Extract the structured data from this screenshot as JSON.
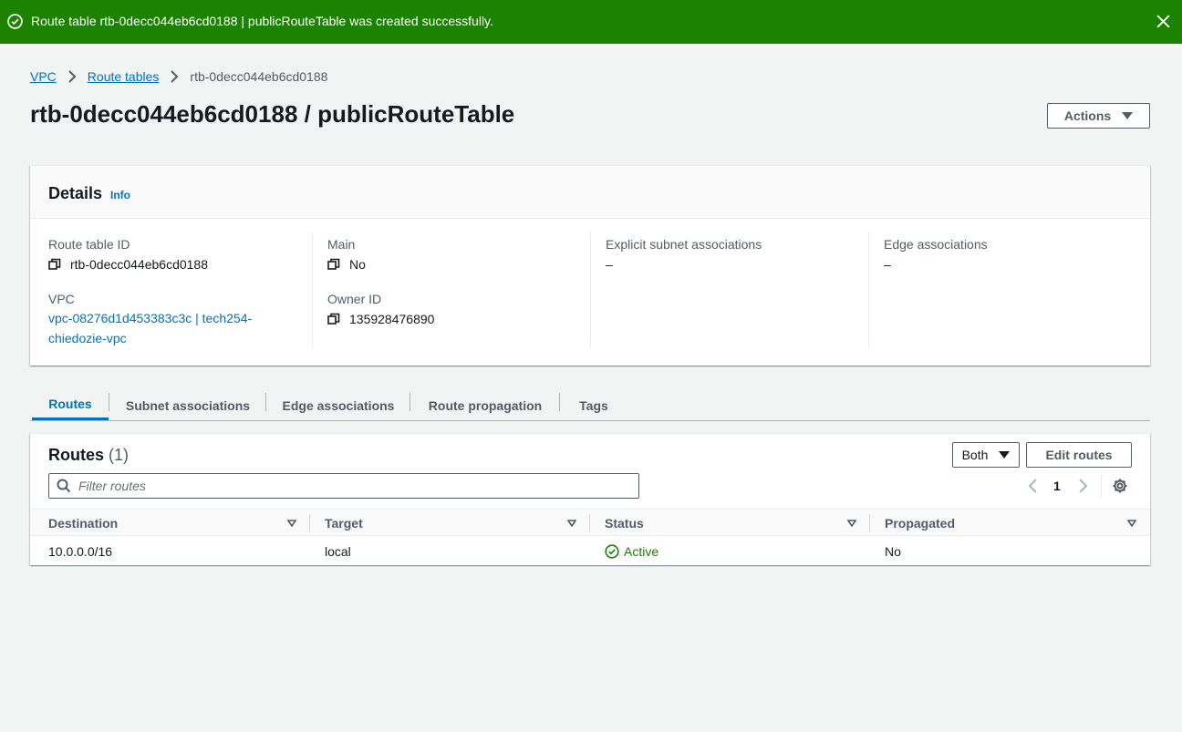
{
  "flash": {
    "message": "Route table rtb-0decc044eb6cd0188 | publicRouteTable was created successfully.",
    "color": "#1d8102"
  },
  "breadcrumb": {
    "items": [
      "VPC",
      "Route tables"
    ],
    "current": "rtb-0decc044eb6cd0188"
  },
  "page": {
    "title": "rtb-0decc044eb6cd0188 / publicRouteTable",
    "actions_label": "Actions"
  },
  "details": {
    "title": "Details",
    "info_label": "Info",
    "route_table_id_label": "Route table ID",
    "route_table_id": "rtb-0decc044eb6cd0188",
    "main_label": "Main",
    "main_value": "No",
    "explicit_subnet_label": "Explicit subnet associations",
    "explicit_subnet_value": "–",
    "edge_label": "Edge associations",
    "edge_value": "–",
    "vpc_label": "VPC",
    "vpc_value": "vpc-08276d1d453383c3c | tech254-chiedozie-vpc",
    "owner_label": "Owner ID",
    "owner_value": "135928476890"
  },
  "tabs": [
    "Routes",
    "Subnet associations",
    "Edge associations",
    "Route propagation",
    "Tags"
  ],
  "routes": {
    "title": "Routes",
    "count": "(1)",
    "filter_select": "Both",
    "edit_label": "Edit routes",
    "filter_placeholder": "Filter routes",
    "page_number": "1",
    "columns": [
      "Destination",
      "Target",
      "Status",
      "Propagated"
    ],
    "rows": [
      {
        "destination": "10.0.0.0/16",
        "target": "local",
        "status": "Active",
        "propagated": "No"
      }
    ],
    "status_color": "#1d8102"
  },
  "colors": {
    "link": "#0073bb",
    "background": "#f2f3f3"
  }
}
